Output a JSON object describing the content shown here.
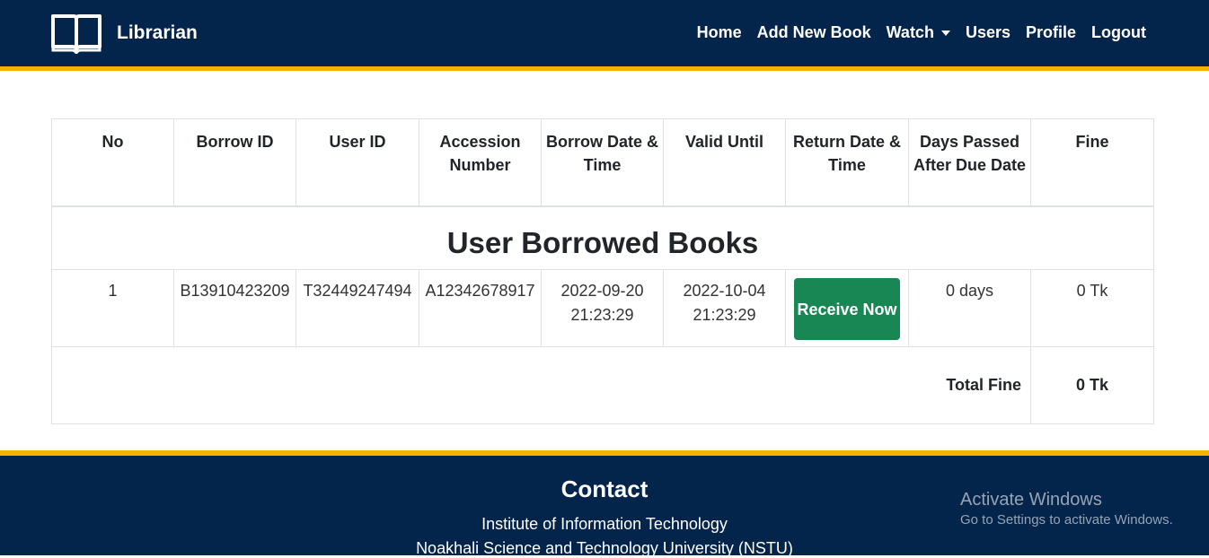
{
  "navbar": {
    "brand": "Librarian",
    "brand_icon": "open-book-icon",
    "links": [
      "Home",
      "Add New Book",
      "Watch",
      "Users",
      "Profile",
      "Logout"
    ]
  },
  "table": {
    "title": "User Borrowed Books",
    "headers": [
      "No",
      "Borrow ID",
      "User ID",
      "Accession Number",
      "Borrow Date & Time",
      "Valid Until",
      "Return Date & Time",
      "Days Passed After Due Date",
      "Fine"
    ],
    "rows": [
      {
        "no": "1",
        "borrow_id": "B13910423209",
        "user_id": "T32449247494",
        "accession": "A12342678917",
        "borrow_date": "2022-09-20 21:23:29",
        "valid_until": "2022-10-04 21:23:29",
        "action_label": "Receive Now",
        "days_passed": "0 days",
        "fine": "0 Tk"
      }
    ],
    "total_label": "Total Fine",
    "total_value": "0 Tk"
  },
  "footer": {
    "title": "Contact",
    "line1": "Institute of Information Technology",
    "line2": "Noakhali Science and Technology University (NSTU)"
  },
  "watermark": {
    "title": "Activate Windows",
    "subtitle": "Go to Settings to activate Windows."
  },
  "colors": {
    "navbar_bg": "#03244b",
    "accent": "#f5b301",
    "button_green": "#198754"
  }
}
